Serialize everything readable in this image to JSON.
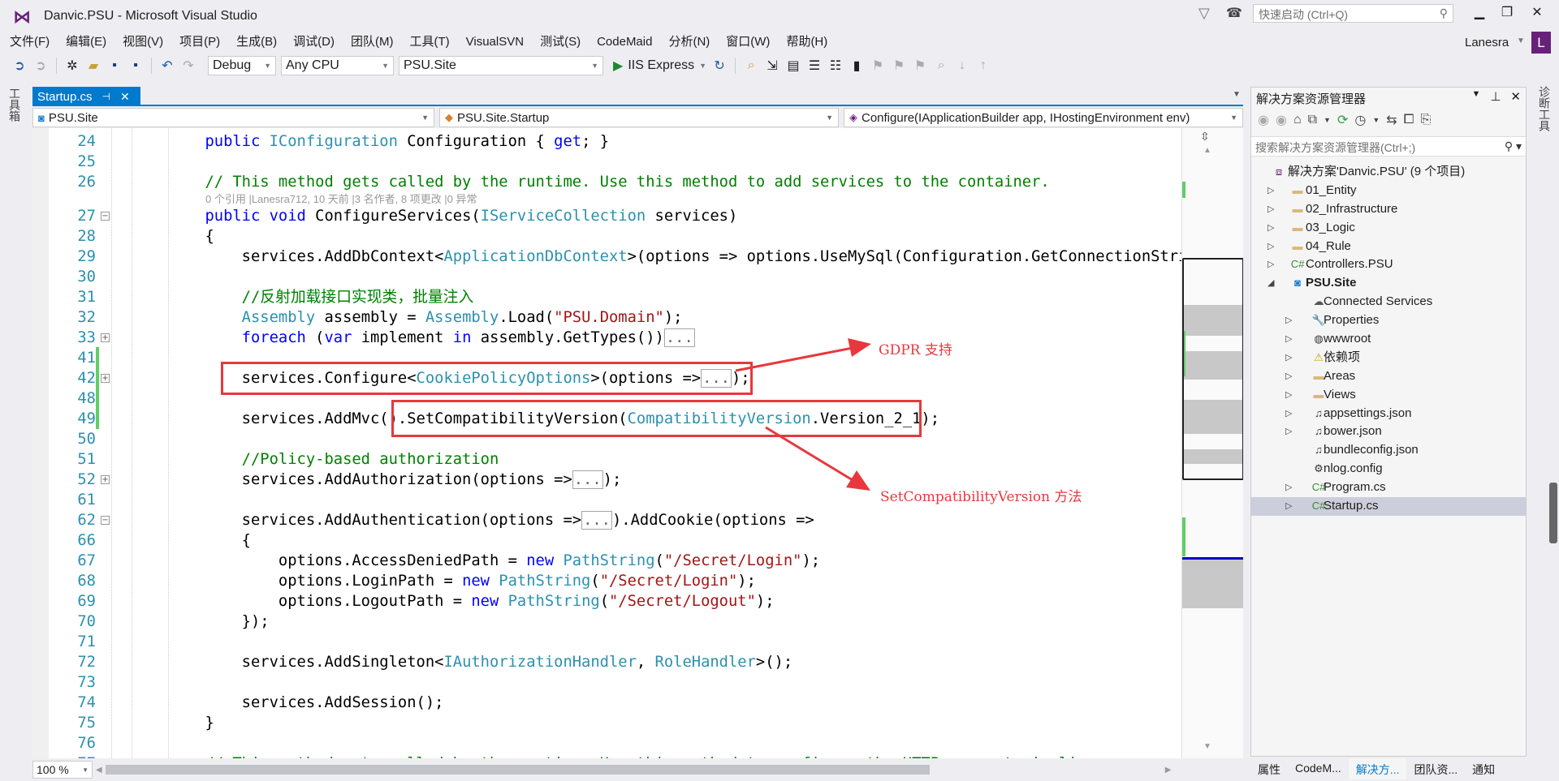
{
  "window": {
    "title": "Danvic.PSU - Microsoft Visual Studio",
    "quick_launch_placeholder": "快速启动 (Ctrl+Q)",
    "user": "Lanesra",
    "avatar_letter": "L"
  },
  "menu": [
    "文件(F)",
    "编辑(E)",
    "视图(V)",
    "项目(P)",
    "生成(B)",
    "调试(D)",
    "团队(M)",
    "工具(T)",
    "VisualSVN",
    "测试(S)",
    "CodeMaid",
    "分析(N)",
    "窗口(W)",
    "帮助(H)"
  ],
  "toolbar": {
    "configuration": "Debug",
    "platform": "Any CPU",
    "startup_project": "PSU.Site",
    "run_target": "IIS Express",
    "icons": [
      "back-icon",
      "forward-icon",
      "new-project-icon",
      "open-icon",
      "save-icon",
      "save-all-icon",
      "undo-icon",
      "redo-icon"
    ]
  },
  "side_strips": {
    "left": "工具箱",
    "right": "诊断工具"
  },
  "editor": {
    "tab": "Startup.cs",
    "nav": {
      "project": "PSU.Site",
      "class": "PSU.Site.Startup",
      "member": "Configure(IApplicationBuilder app, IHostingEnvironment env)"
    },
    "zoom": "100 %",
    "lines": [
      {
        "n": "24",
        "t": [
          [
            "kw",
            "        public "
          ],
          [
            "ty",
            "IConfiguration"
          ],
          [
            "pl",
            " Configuration { "
          ],
          [
            "kw",
            "get"
          ],
          [
            "pl",
            "; }"
          ]
        ]
      },
      {
        "n": "25",
        "t": []
      },
      {
        "n": "26",
        "t": [
          [
            "cm",
            "        // This method gets called by the runtime. Use this method to add services to the container."
          ]
        ]
      },
      {
        "lens": "0 个引用 |Lanesra712, 10 天前 |3 名作者, 8 项更改 |0 异常"
      },
      {
        "n": "27",
        "fold": "−",
        "t": [
          [
            "kw",
            "        public void "
          ],
          [
            "pl",
            "ConfigureServices("
          ],
          [
            "ty",
            "IServiceCollection"
          ],
          [
            "pl",
            " services)"
          ]
        ]
      },
      {
        "n": "28",
        "t": [
          [
            "pl",
            "        {"
          ]
        ]
      },
      {
        "n": "29",
        "t": [
          [
            "pl",
            "            services.AddDbContext<"
          ],
          [
            "ty",
            "ApplicationDbContext"
          ],
          [
            "pl",
            ">(options => options.UseMySql(Configuration.GetConnectionString"
          ]
        ]
      },
      {
        "n": "30",
        "t": []
      },
      {
        "n": "31",
        "t": [
          [
            "cm",
            "            //反射加载接口实现类，批量注入"
          ]
        ]
      },
      {
        "n": "32",
        "t": [
          [
            "ty",
            "            Assembly"
          ],
          [
            "pl",
            " assembly = "
          ],
          [
            "ty",
            "Assembly"
          ],
          [
            "pl",
            ".Load("
          ],
          [
            "st",
            "\"PSU.Domain\""
          ],
          [
            "pl",
            ");"
          ]
        ]
      },
      {
        "n": "33",
        "fold": "+",
        "t": [
          [
            "kw",
            "            foreach"
          ],
          [
            "pl",
            " ("
          ],
          [
            "kw",
            "var"
          ],
          [
            "pl",
            " implement "
          ],
          [
            "kw",
            "in"
          ],
          [
            "pl",
            " assembly.GetTypes())"
          ],
          [
            "box",
            "..."
          ]
        ]
      },
      {
        "n": "41",
        "t": []
      },
      {
        "n": "42",
        "fold": "+",
        "t": [
          [
            "pl",
            "            services.Configure<"
          ],
          [
            "ty",
            "CookiePolicyOptions"
          ],
          [
            "pl",
            ">(options =>"
          ],
          [
            "box",
            "..."
          ],
          [
            "pl",
            ");"
          ]
        ]
      },
      {
        "n": "48",
        "t": []
      },
      {
        "n": "49",
        "t": [
          [
            "pl",
            "            services.AddMvc().SetCompatibilityVersion("
          ],
          [
            "ty",
            "CompatibilityVersion"
          ],
          [
            "pl",
            ".Version_2_1);"
          ]
        ]
      },
      {
        "n": "50",
        "t": []
      },
      {
        "n": "51",
        "t": [
          [
            "cm",
            "            //Policy-based authorization"
          ]
        ]
      },
      {
        "n": "52",
        "fold": "+",
        "t": [
          [
            "pl",
            "            services.AddAuthorization(options =>"
          ],
          [
            "box",
            "..."
          ],
          [
            "pl",
            ");"
          ]
        ]
      },
      {
        "n": "61",
        "t": []
      },
      {
        "n": "62",
        "fold": "−",
        "t": [
          [
            "pl",
            "            services.AddAuthentication(options =>"
          ],
          [
            "box",
            "..."
          ],
          [
            "pl",
            ").AddCookie(options =>"
          ]
        ]
      },
      {
        "n": "66",
        "t": [
          [
            "pl",
            "            {"
          ]
        ]
      },
      {
        "n": "67",
        "t": [
          [
            "pl",
            "                options.AccessDeniedPath = "
          ],
          [
            "kw",
            "new "
          ],
          [
            "ty",
            "PathString"
          ],
          [
            "pl",
            "("
          ],
          [
            "st",
            "\"/Secret/Login\""
          ],
          [
            "pl",
            ");"
          ]
        ]
      },
      {
        "n": "68",
        "t": [
          [
            "pl",
            "                options.LoginPath = "
          ],
          [
            "kw",
            "new "
          ],
          [
            "ty",
            "PathString"
          ],
          [
            "pl",
            "("
          ],
          [
            "st",
            "\"/Secret/Login\""
          ],
          [
            "pl",
            ");"
          ]
        ]
      },
      {
        "n": "69",
        "t": [
          [
            "pl",
            "                options.LogoutPath = "
          ],
          [
            "kw",
            "new "
          ],
          [
            "ty",
            "PathString"
          ],
          [
            "pl",
            "("
          ],
          [
            "st",
            "\"/Secret/Logout\""
          ],
          [
            "pl",
            ");"
          ]
        ]
      },
      {
        "n": "70",
        "t": [
          [
            "pl",
            "            });"
          ]
        ]
      },
      {
        "n": "71",
        "t": []
      },
      {
        "n": "72",
        "t": [
          [
            "pl",
            "            services.AddSingleton<"
          ],
          [
            "ty",
            "IAuthorizationHandler"
          ],
          [
            "pl",
            ", "
          ],
          [
            "ty",
            "RoleHandler"
          ],
          [
            "pl",
            ">();"
          ]
        ]
      },
      {
        "n": "73",
        "t": []
      },
      {
        "n": "74",
        "t": [
          [
            "pl",
            "            services.AddSession();"
          ]
        ]
      },
      {
        "n": "75",
        "t": [
          [
            "pl",
            "        }"
          ]
        ]
      },
      {
        "n": "76",
        "t": []
      },
      {
        "n": "77",
        "t": [
          [
            "cm",
            "        // This method gets called by the runtime. Use this method to configure the HTTP request pipeline."
          ]
        ]
      }
    ]
  },
  "annotations": {
    "gdpr": "GDPR 支持",
    "compat": "SetCompatibilityVersion 方法",
    "color": "#e8383d"
  },
  "solution_explorer": {
    "title": "解决方案资源管理器",
    "search_placeholder": "搜索解决方案资源管理器(Ctrl+;)",
    "items": [
      {
        "label": "解决方案'Danvic.PSU' (9 个项目)",
        "level": 0,
        "icon": "solution-icon",
        "arrow": ""
      },
      {
        "label": "01_Entity",
        "level": 1,
        "icon": "folder-icon",
        "arrow": "collapsed"
      },
      {
        "label": "02_Infrastructure",
        "level": 1,
        "icon": "folder-icon",
        "arrow": "collapsed"
      },
      {
        "label": "03_Logic",
        "level": 1,
        "icon": "folder-icon",
        "arrow": "collapsed"
      },
      {
        "label": "04_Rule",
        "level": 1,
        "icon": "folder-icon",
        "arrow": "collapsed"
      },
      {
        "label": "Controllers.PSU",
        "level": 1,
        "icon": "csharp-project-icon",
        "arrow": "collapsed"
      },
      {
        "label": "PSU.Site",
        "level": 1,
        "icon": "web-project-icon",
        "arrow": "expanded",
        "bold": true
      },
      {
        "label": "Connected Services",
        "level": 2,
        "icon": "connected-services-icon",
        "arrow": ""
      },
      {
        "label": "Properties",
        "level": 2,
        "icon": "wrench-icon",
        "arrow": "collapsed"
      },
      {
        "label": "wwwroot",
        "level": 2,
        "icon": "globe-icon",
        "arrow": "collapsed"
      },
      {
        "label": "依赖项",
        "level": 2,
        "icon": "dependencies-warning-icon",
        "arrow": "collapsed"
      },
      {
        "label": "Areas",
        "level": 2,
        "icon": "folder-icon",
        "arrow": "collapsed"
      },
      {
        "label": "Views",
        "level": 2,
        "icon": "folder-icon",
        "arrow": "collapsed"
      },
      {
        "label": "appsettings.json",
        "level": 2,
        "icon": "json-file-icon",
        "arrow": "collapsed"
      },
      {
        "label": "bower.json",
        "level": 2,
        "icon": "json-file-icon",
        "arrow": "collapsed"
      },
      {
        "label": "bundleconfig.json",
        "level": 2,
        "icon": "json-file-icon",
        "arrow": ""
      },
      {
        "label": "nlog.config",
        "level": 2,
        "icon": "config-file-icon",
        "arrow": ""
      },
      {
        "label": "Program.cs",
        "level": 2,
        "icon": "csharp-file-icon",
        "arrow": "collapsed"
      },
      {
        "label": "Startup.cs",
        "level": 2,
        "icon": "csharp-file-icon",
        "arrow": "collapsed",
        "selected": true
      }
    ],
    "tabs": [
      {
        "label": "属性",
        "active": false
      },
      {
        "label": "CodeM...",
        "active": false
      },
      {
        "label": "解决方...",
        "active": true
      },
      {
        "label": "团队资...",
        "active": false
      },
      {
        "label": "通知",
        "active": false
      }
    ]
  },
  "colors": {
    "accent": "#007acc",
    "keyword": "#0000ff",
    "type": "#2b91af",
    "string": "#a31515",
    "comment": "#008000",
    "brand": "#68217a"
  }
}
